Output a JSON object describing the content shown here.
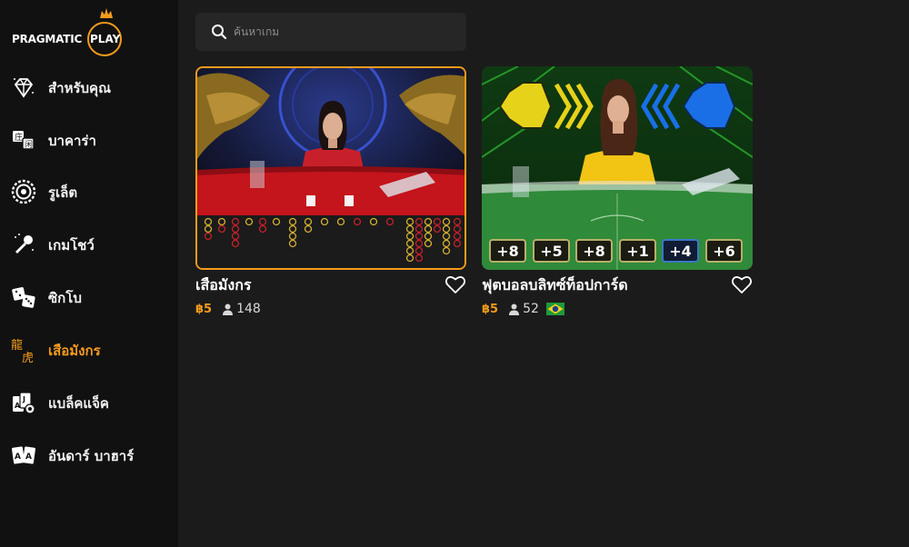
{
  "brand": {
    "name": "PRAGMATIC",
    "play": "PLAY"
  },
  "sidebar": {
    "items": [
      {
        "label": "สำหรับคุณ",
        "icon": "diamond-icon",
        "active": false
      },
      {
        "label": "บาคาร่า",
        "icon": "baccarat-icon",
        "active": false
      },
      {
        "label": "รูเล็ต",
        "icon": "roulette-icon",
        "active": false
      },
      {
        "label": "เกมโชว์",
        "icon": "microphone-icon",
        "active": false
      },
      {
        "label": "ซิกโบ",
        "icon": "dice-icon",
        "active": false
      },
      {
        "label": "เสือมังกร",
        "icon": "dragon-tiger-icon",
        "active": true
      },
      {
        "label": "แบล็คแจ็ค",
        "icon": "cards-chip-icon",
        "active": false
      },
      {
        "label": "อันดาร์ บาฮาร์",
        "icon": "aces-icon",
        "active": false
      }
    ]
  },
  "search": {
    "placeholder": "ค้นหาเกม",
    "value": ""
  },
  "games": [
    {
      "title": "เสือมังกร",
      "bet": "฿5",
      "players": "148",
      "selected": true
    },
    {
      "title": "ฟุตบอลบลิทซ์ท็อปการ์ด",
      "bet": "฿5",
      "players": "52",
      "flag": "brazil-flag-icon",
      "selected": false,
      "multipliers": [
        "+8",
        "+5",
        "+8",
        "+1",
        "+4",
        "+6"
      ]
    }
  ],
  "colors": {
    "accent": "#f39b1c",
    "background": "#1b1b1b",
    "sidebar": "#111111"
  }
}
